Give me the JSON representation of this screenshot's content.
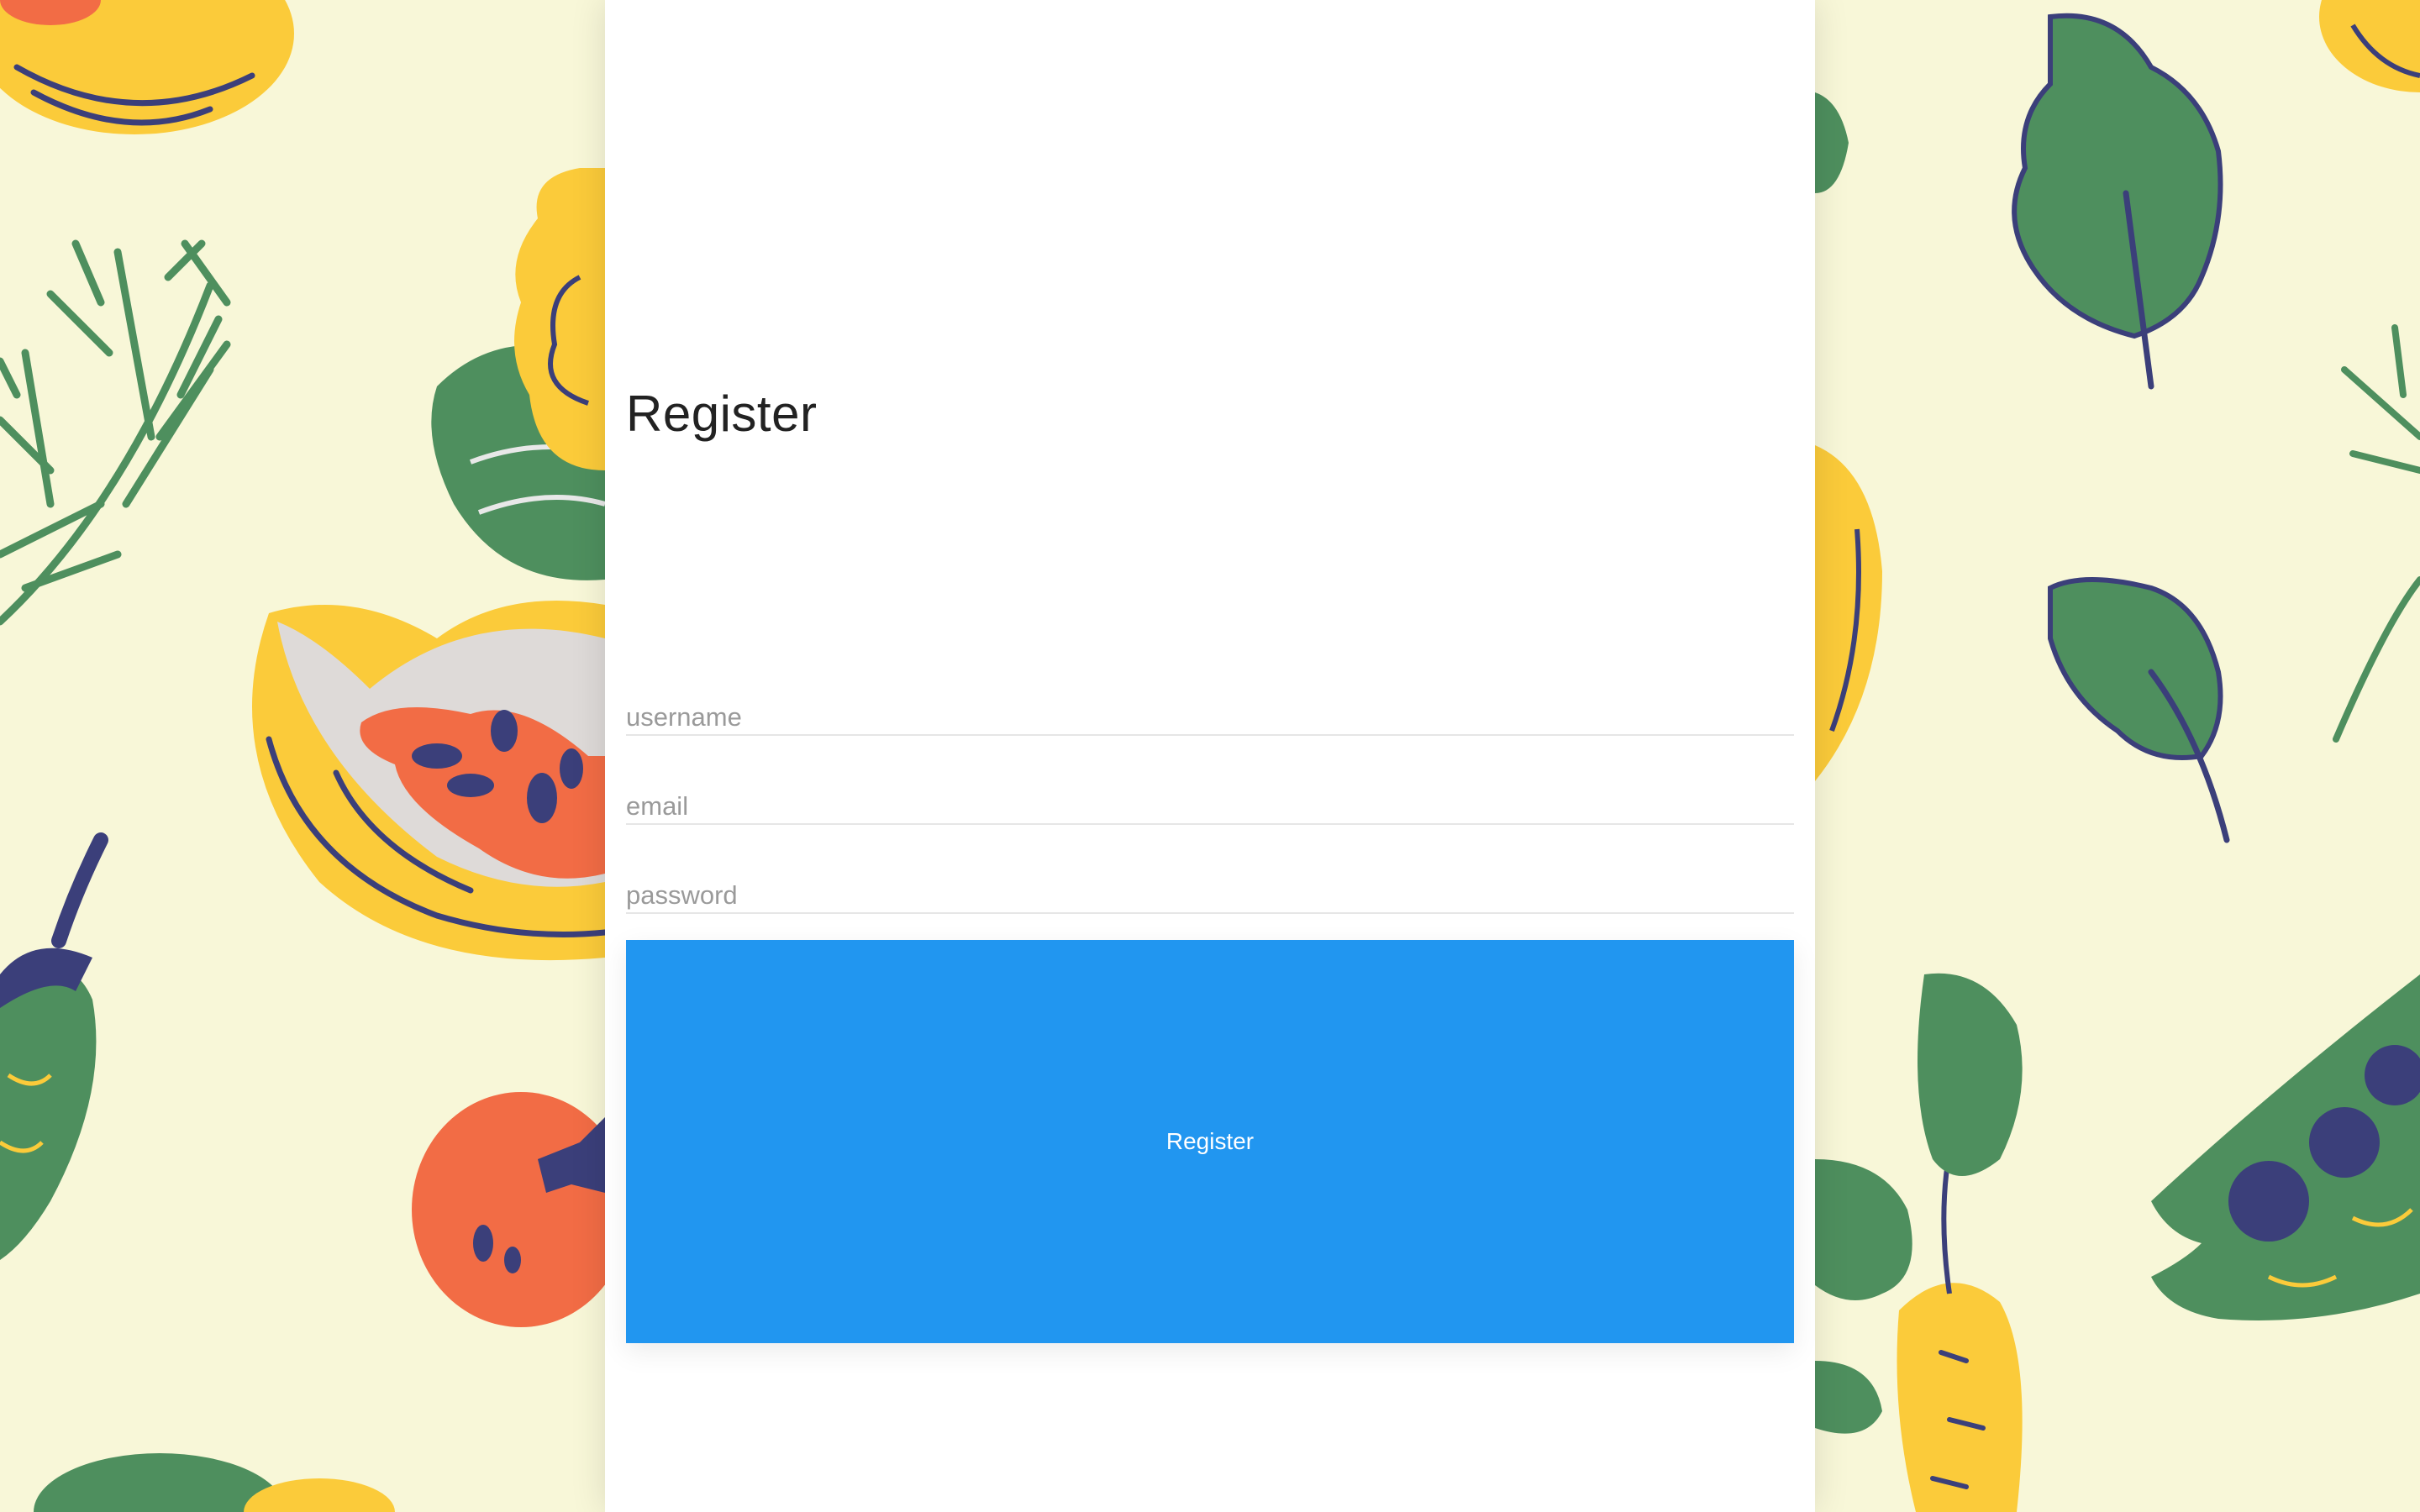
{
  "form": {
    "title": "Register",
    "fields": [
      {
        "name": "username",
        "placeholder": "username",
        "value": ""
      },
      {
        "name": "email",
        "placeholder": "email",
        "value": ""
      },
      {
        "name": "password",
        "placeholder": "password",
        "value": ""
      }
    ],
    "submit_label": "Register"
  },
  "colors": {
    "background": "#f8f7d8",
    "panel": "#ffffff",
    "button": "#2196f0",
    "leaf_green": "#4e8f5e",
    "fruit_yellow": "#f8c93a",
    "tomato_red": "#f26c45",
    "outline_navy": "#3b3f7a"
  },
  "background_illustration": "vegetable-pattern"
}
